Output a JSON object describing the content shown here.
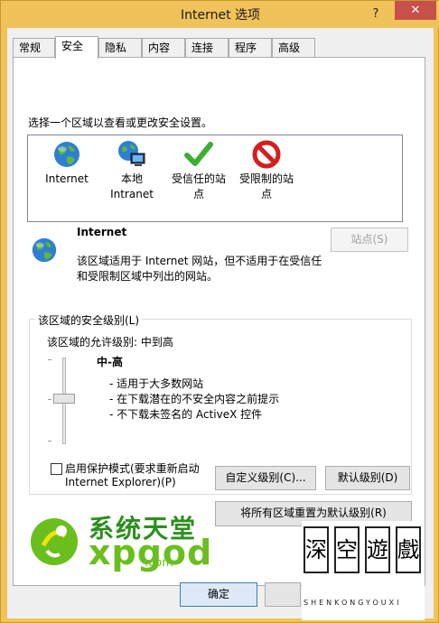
{
  "window": {
    "title": "Internet 选项",
    "help_label": "?",
    "close_label": "✕"
  },
  "tabs": [
    "常规",
    "安全",
    "隐私",
    "内容",
    "连接",
    "程序",
    "高级"
  ],
  "active_tab": "安全",
  "security": {
    "select_zone_prompt": "选择一个区域以查看或更改安全设置。",
    "zones": [
      {
        "label_line1": "Internet",
        "label_line2": "",
        "icon": "globe-icon"
      },
      {
        "label_line1": "本地",
        "label_line2": "Intranet",
        "icon": "computer-globe-icon"
      },
      {
        "label_line1": "受信任的站",
        "label_line2": "点",
        "icon": "checkmark-icon"
      },
      {
        "label_line1": "受限制的站",
        "label_line2": "点",
        "icon": "forbidden-icon"
      }
    ],
    "selected_zone": {
      "name": "Internet",
      "desc_line1": "该区域适用于 Internet 网站，但不适用于在受信任",
      "desc_line2": "和受限制区域中列出的网站。"
    },
    "sites_button": "站点(S)",
    "level_group_label": "该区域的安全级别(L)",
    "allowed_levels": "该区域的允许级别: 中到高",
    "level_name": "中-高",
    "level_bullets": [
      "- 适用于大多数网站",
      "- 在下载潜在的不安全内容之前提示",
      "- 不下载未签名的 ActiveX 控件"
    ],
    "slider_level": 0.5,
    "protected_mode_line1": "启用保护模式(要求重新启动",
    "protected_mode_line2": "Internet Explorer)(P)",
    "protected_mode_checked": false,
    "custom_level_button": "自定义级别(C)...",
    "default_level_button": "默认级别(D)",
    "reset_all_button": "将所有区域重置为默认级别(R)"
  },
  "footer": {
    "ok_button": "确定"
  },
  "watermarks": {
    "left_text1": "系统天堂",
    "left_text2": "xpgod",
    "left_text3": ".com",
    "right_glyphs": [
      "深",
      "空",
      "遊",
      "戲"
    ],
    "right_caption": "SHENKONGYOUXI"
  },
  "colors": {
    "title_bar": "#f0c25a",
    "close_button": "#c7504b",
    "logo_green": "#6abf1e",
    "logo_yellow": "#f1e400"
  }
}
